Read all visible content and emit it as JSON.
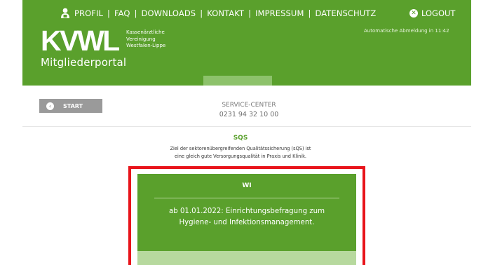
{
  "header": {
    "nav": [
      {
        "name": "nav-profil",
        "label": "PROFIL"
      },
      {
        "name": "nav-faq",
        "label": "FAQ"
      },
      {
        "name": "nav-downloads",
        "label": "DOWNLOADS"
      },
      {
        "name": "nav-kontakt",
        "label": "KONTAKT"
      },
      {
        "name": "nav-impressum",
        "label": "IMPRESSUM"
      },
      {
        "name": "nav-datenschutz",
        "label": "DATENSCHUTZ"
      }
    ],
    "separator": "|",
    "logout_label": "LOGOUT",
    "auto_logout": "Automatische Abmeldung in 11:42",
    "logo_text": "KVWL",
    "logo_sub": [
      "Kassenärztliche",
      "Vereinigung",
      "Westfalen-Lippe"
    ],
    "portal_title": "Mitgliederportal"
  },
  "toolbar": {
    "start_label": "START",
    "service_title": "SERVICE-CENTER",
    "service_phone": "0231 94 32 10 00"
  },
  "main": {
    "title": "SQS",
    "description_lines": [
      "Ziel der sektorenübergreifenden Qualitätssicherung (sQS) ist",
      "eine gleich gute Versorgungsqualität in Praxis und Klinik."
    ],
    "card": {
      "title": "WI",
      "text_lines": [
        "ab 01.01.2022: Einrichtungsbefragung zum",
        "Hygiene- und Infektionsmanagement."
      ]
    }
  },
  "colors": {
    "brand_green": "#5aa02c",
    "light_green": "#b7d99e",
    "highlight_red": "#e8141b",
    "button_gray": "#9a9a9a"
  },
  "icons": {
    "profile": "user-badge-icon",
    "logout": "close-circle-icon",
    "start": "chevron-left-circle-icon"
  }
}
